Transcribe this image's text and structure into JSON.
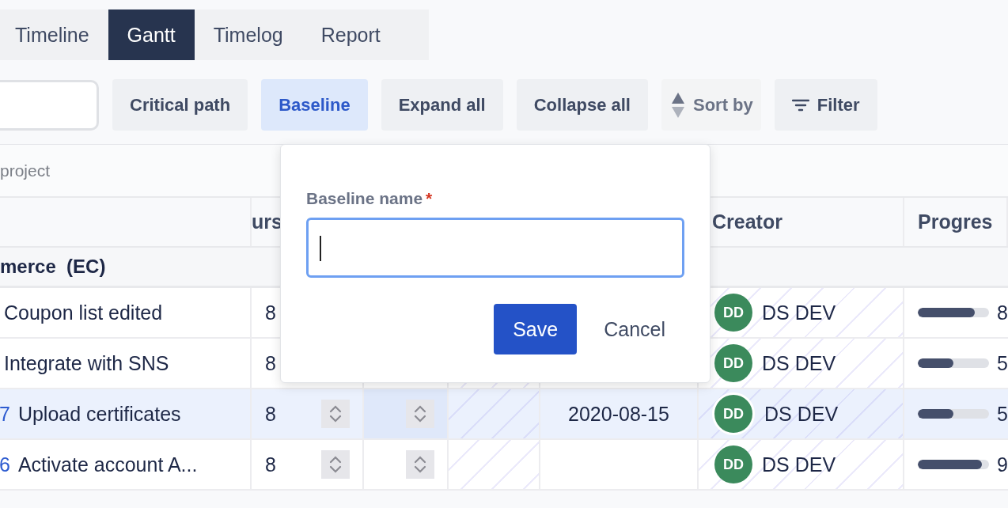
{
  "tabs": [
    {
      "label": "Timeline",
      "selected": false
    },
    {
      "label": "Gantt",
      "selected": true
    },
    {
      "label": "Timelog",
      "selected": false
    },
    {
      "label": "Report",
      "selected": false
    }
  ],
  "toolbar": [
    {
      "kind": "plain",
      "label": "Critical path",
      "selected": false,
      "disabled": false
    },
    {
      "kind": "plain",
      "label": "Baseline",
      "selected": true,
      "disabled": false
    },
    {
      "kind": "plain",
      "label": "Expand all",
      "selected": false,
      "disabled": false
    },
    {
      "kind": "plain",
      "label": "Collapse all",
      "selected": false,
      "disabled": false
    },
    {
      "kind": "sort",
      "label": "Sort by",
      "selected": false,
      "disabled": true
    },
    {
      "kind": "filter",
      "label": "Filter",
      "selected": false,
      "disabled": false
    }
  ],
  "project_field": {
    "placeholder": "project"
  },
  "table": {
    "columns": [
      "",
      "urs",
      "",
      "",
      "",
      "Creator",
      "Progres"
    ],
    "group": "merce  (EC)",
    "rows": [
      {
        "id": "",
        "name": "Coupon list edited",
        "hours": "8",
        "date": "",
        "initials": "DD",
        "creator": "DS DEV",
        "level": 0.8,
        "percent": "8",
        "selected": false
      },
      {
        "id": "",
        "name": "Integrate with SNS",
        "hours": "8",
        "date": "",
        "initials": "DD",
        "creator": "DS DEV",
        "level": 0.5,
        "percent": "5",
        "selected": false
      },
      {
        "id": "7",
        "name": "Upload certificates",
        "hours": "8",
        "date": "2020-08-15",
        "initials": "DD",
        "creator": "DS DEV",
        "level": 0.5,
        "percent": "5",
        "selected": true
      },
      {
        "id": "6",
        "name": "Activate account A...",
        "hours": "8",
        "date": "",
        "initials": "DD",
        "creator": "DS DEV",
        "level": 0.9,
        "percent": "9",
        "selected": false
      }
    ]
  },
  "dialog": {
    "label": "Baseline name",
    "required_mark": "*",
    "buttons": [
      {
        "kind": "primary",
        "label": "Save"
      },
      {
        "kind": "secondary",
        "label": "Cancel"
      }
    ]
  }
}
